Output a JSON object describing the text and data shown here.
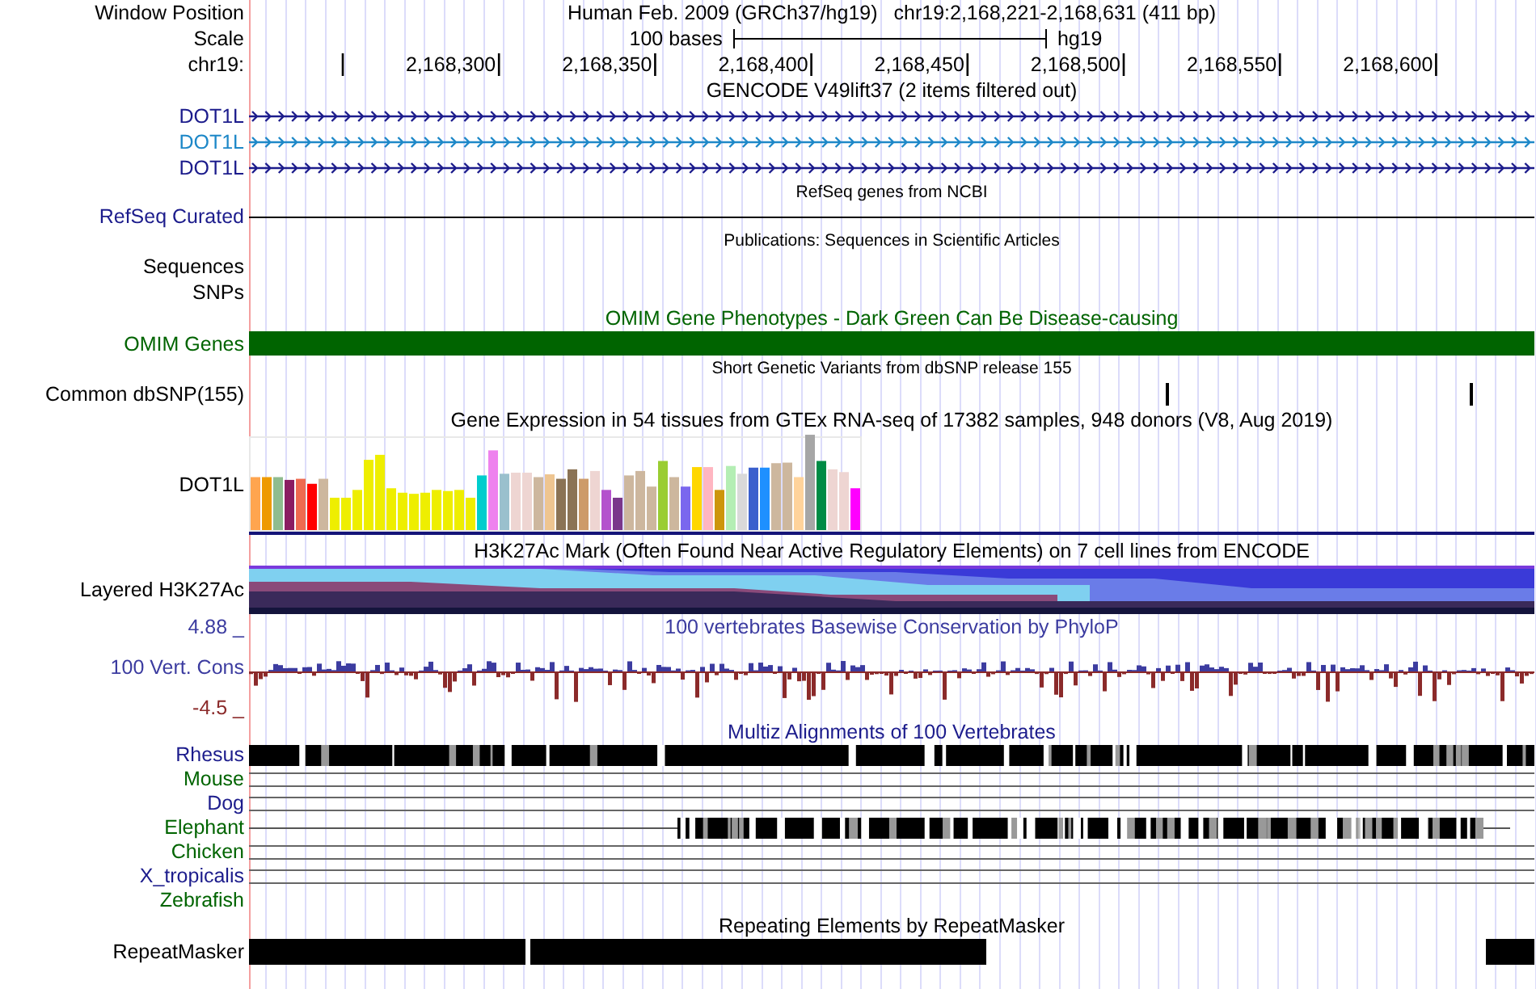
{
  "header": {
    "label": "Window Position",
    "assembly": "Human Feb. 2009 (GRCh37/hg19)",
    "position": "chr19:2,168,221-2,168,631 (411 bp)"
  },
  "scale": {
    "label": "Scale",
    "length": "100 bases",
    "assembly": "hg19"
  },
  "ruler": {
    "label": "chr19:",
    "ticks": [
      "2,168,300",
      "2,168,350",
      "2,168,400",
      "2,168,450",
      "2,168,500",
      "2,168,550",
      "2,168,600"
    ]
  },
  "rows": [
    {
      "kind": "title",
      "title": "GENCODE V49lift37 (2 items filtered out)"
    },
    {
      "kind": "gene",
      "label": "DOT1L",
      "color": "#1c1c8c"
    },
    {
      "kind": "gene",
      "label": "DOT1L",
      "color": "#1e88c8"
    },
    {
      "kind": "gene",
      "label": "DOT1L",
      "color": "#1c1c8c"
    },
    {
      "kind": "note",
      "title": "RefSeq genes from NCBI"
    },
    {
      "kind": "line",
      "label": "RefSeq Curated",
      "color": "#1c1c8c"
    },
    {
      "kind": "note",
      "title": "Publications: Sequences in Scientific Articles"
    },
    {
      "kind": "label",
      "label": "Sequences"
    },
    {
      "kind": "label",
      "label": "SNPs"
    },
    {
      "kind": "title",
      "title": "OMIM Gene Phenotypes - Dark Green Can Be Disease-causing",
      "color": "#006400"
    },
    {
      "kind": "bar",
      "label": "OMIM Genes",
      "color": "#006400"
    },
    {
      "kind": "note",
      "title": "Short Genetic Variants from dbSNP release 155"
    },
    {
      "kind": "snp",
      "label": "Common dbSNP(155)"
    },
    {
      "kind": "title",
      "title": "Gene Expression in 54 tissues from GTEx RNA-seq of 17382 samples, 948 donors (V8, Aug 2019)"
    },
    {
      "kind": "expression",
      "label": "DOT1L"
    },
    {
      "kind": "title",
      "title": "H3K27Ac Mark (Often Found Near Active Regulatory Elements) on 7 cell lines from ENCODE"
    },
    {
      "kind": "layered",
      "label": "Layered H3K27Ac"
    },
    {
      "kind": "wiggle",
      "title": "100 vertebrates Basewise Conservation by PhyloP",
      "label": "100 Vert. Cons",
      "max": "4.88 _",
      "min": "-4.5 _",
      "color": "#3c3ca0"
    },
    {
      "kind": "title",
      "title": "Multiz Alignments of 100 Vertebrates",
      "color": "#1c1c8c"
    },
    {
      "kind": "aligned",
      "label": "Rhesus",
      "color": "#1c1c8c"
    },
    {
      "kind": "gaps",
      "label": "Mouse",
      "color": "#006400"
    },
    {
      "kind": "gaps",
      "label": "Dog",
      "color": "#1c1c8c"
    },
    {
      "kind": "partial",
      "label": "Elephant",
      "color": "#006400"
    },
    {
      "kind": "gaps",
      "label": "Chicken",
      "color": "#006400"
    },
    {
      "kind": "gaps",
      "label": "X_tropicalis",
      "color": "#1c1c8c"
    },
    {
      "kind": "blank",
      "label": "Zebrafish",
      "color": "#006400"
    },
    {
      "kind": "title",
      "title": "Repeating Elements by RepeatMasker"
    },
    {
      "kind": "repeats",
      "label": "RepeatMasker"
    }
  ]
}
